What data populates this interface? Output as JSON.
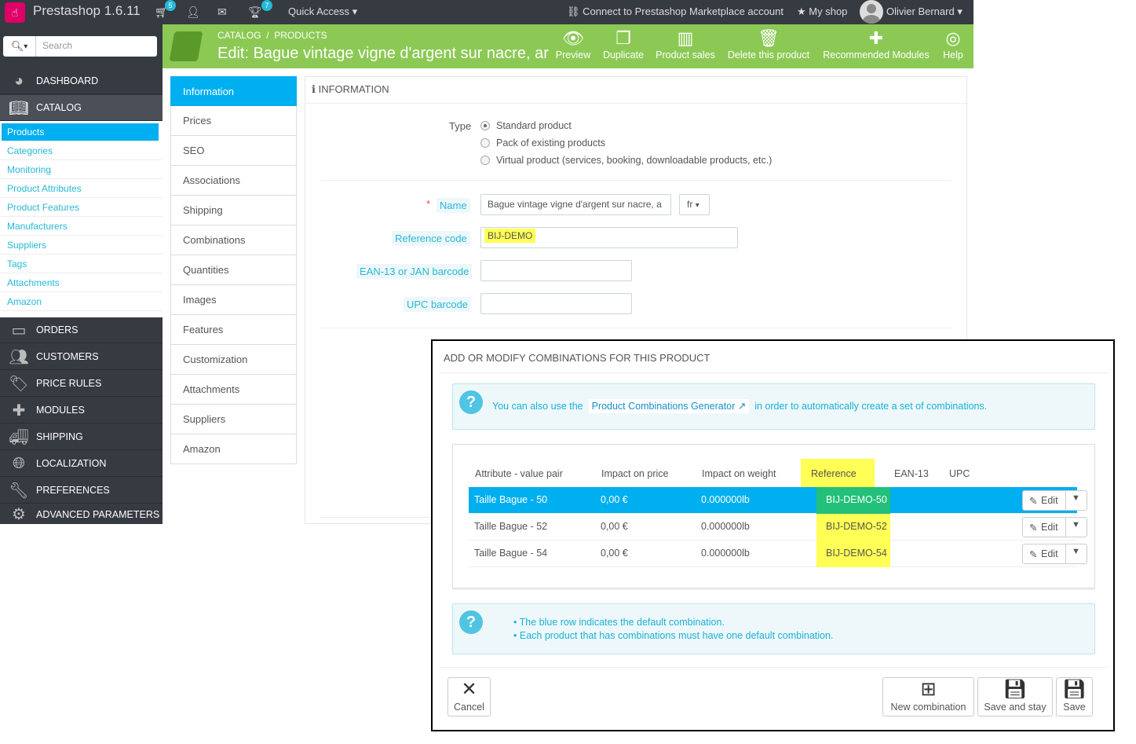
{
  "topbar": {
    "app_title": "Prestashop 1.6.11",
    "cart_count": "5",
    "trophy_count": "7",
    "quick_access": "Quick Access",
    "connect": "Connect to Prestashop Marketplace account",
    "my_shop": "My shop",
    "user": "Olivier Bernard"
  },
  "sidebar": {
    "search_placeholder": "Search",
    "top_items": {
      "dashboard": "DASHBOARD",
      "catalog": "CATALOG",
      "orders": "ORDERS",
      "customers": "CUSTOMERS",
      "price_rules": "PRICE RULES",
      "modules": "MODULES",
      "shipping": "SHIPPING",
      "localization": "LOCALIZATION",
      "preferences": "PREFERENCES",
      "advanced": "ADVANCED PARAMETERS"
    },
    "catalog_items": [
      "Products",
      "Categories",
      "Monitoring",
      "Product Attributes",
      "Product Features",
      "Manufacturers",
      "Suppliers",
      "Tags",
      "Attachments",
      "Amazon"
    ]
  },
  "header": {
    "breadcrumb_catalog": "CATALOG",
    "breadcrumb_sep": "/",
    "breadcrumb_products": "PRODUCTS",
    "title": "Edit: Bague vintage vigne d'argent sur nacre, ar",
    "toolbar": {
      "preview": "Preview",
      "duplicate": "Duplicate",
      "product_sales": "Product sales",
      "delete": "Delete this product",
      "recommended": "Recommended Modules",
      "help": "Help"
    }
  },
  "tabs": [
    "Information",
    "Prices",
    "SEO",
    "Associations",
    "Shipping",
    "Combinations",
    "Quantities",
    "Images",
    "Features",
    "Customization",
    "Attachments",
    "Suppliers",
    "Amazon"
  ],
  "info": {
    "heading": "INFORMATION",
    "type_label": "Type",
    "type_options": [
      "Standard product",
      "Pack of existing products",
      "Virtual product (services, booking, downloadable products, etc.)"
    ],
    "required_star": "*",
    "name_label": "Name",
    "name_value": "Bague vintage vigne d'argent sur nacre, a",
    "lang": "fr",
    "reference_label": "Reference code",
    "reference_value": "BIJ-DEMO",
    "ean_label": "EAN-13 or JAN barcode",
    "ean_value": "",
    "upc_label": "UPC barcode",
    "upc_value": ""
  },
  "modal": {
    "heading": "ADD OR MODIFY COMBINATIONS FOR THIS PRODUCT",
    "alert1_pre": "You can also use the",
    "alert1_link": "Product Combinations Generator",
    "alert1_post": "in order to automatically create a set of combinations.",
    "columns": {
      "attribute": "Attribute - value pair",
      "price": "Impact on price",
      "weight": "Impact on weight",
      "reference": "Reference",
      "ean": "EAN-13",
      "upc": "UPC"
    },
    "rows": [
      {
        "attribute": "Taille Bague - 50",
        "price": "0,00 €",
        "weight": "0.000000lb",
        "reference": "BIJ-DEMO-50",
        "edit": "Edit"
      },
      {
        "attribute": "Taille Bague - 52",
        "price": "0,00 €",
        "weight": "0.000000lb",
        "reference": "BIJ-DEMO-52",
        "edit": "Edit"
      },
      {
        "attribute": "Taille Bague - 54",
        "price": "0,00 €",
        "weight": "0.000000lb",
        "reference": "BIJ-DEMO-54",
        "edit": "Edit"
      }
    ],
    "notes": [
      "The blue row indicates the default combination.",
      "Each product that has combinations must have one default combination."
    ],
    "buttons": {
      "cancel": "Cancel",
      "new_combination": "New combination",
      "save_and_stay": "Save and stay",
      "save": "Save"
    }
  },
  "colors": {
    "sidebar_bg": "#363a41",
    "header_green": "#8bc954",
    "accent_blue": "#00aff0",
    "highlight_yellow": "#ffff55",
    "highlight_green": "#22c07a"
  }
}
